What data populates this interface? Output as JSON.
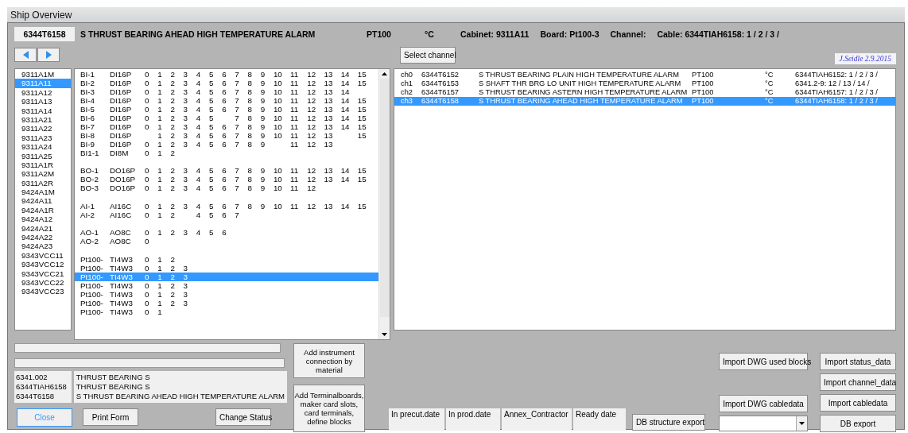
{
  "window": {
    "title": "Ship Overview"
  },
  "header": {
    "tag": "6344T6158",
    "description": "S THRUST BEARING AHEAD HIGH TEMPERATURE ALARM",
    "type": "PT100",
    "unit": "°C",
    "cabinet": "Cabinet: 9311A11",
    "board": "Board: Pt100-3",
    "channel": "Channel:",
    "cable": "Cable: 6344TIAH6158:  1 / 2 / 3 /"
  },
  "select_channel_button": "Select channel",
  "signature": "J.Seidle 2.9.2015",
  "cabinets": [
    {
      "label": "9311A1M",
      "selected": false
    },
    {
      "label": "9311A11",
      "selected": true
    },
    {
      "label": "9311A12",
      "selected": false
    },
    {
      "label": "9311A13",
      "selected": false
    },
    {
      "label": "9311A14",
      "selected": false
    },
    {
      "label": "9311A21",
      "selected": false
    },
    {
      "label": "9311A22",
      "selected": false
    },
    {
      "label": "9311A23",
      "selected": false
    },
    {
      "label": "9311A24",
      "selected": false
    },
    {
      "label": "9311A25",
      "selected": false
    },
    {
      "label": "9311A1R",
      "selected": false
    },
    {
      "label": "9311A2M",
      "selected": false
    },
    {
      "label": "9311A2R",
      "selected": false
    },
    {
      "label": "9424A1M",
      "selected": false
    },
    {
      "label": "9424A11",
      "selected": false
    },
    {
      "label": "9424A1R",
      "selected": false
    },
    {
      "label": "9424A12",
      "selected": false
    },
    {
      "label": "9424A21",
      "selected": false
    },
    {
      "label": "9424A22",
      "selected": false
    },
    {
      "label": "9424A23",
      "selected": false
    },
    {
      "label": "9343VCC11",
      "selected": false
    },
    {
      "label": "9343VCC12",
      "selected": false
    },
    {
      "label": "9343VCC21",
      "selected": false
    },
    {
      "label": "9343VCC22",
      "selected": false
    },
    {
      "label": "9343VCC23",
      "selected": false
    }
  ],
  "board_groups": [
    {
      "rows": [
        {
          "name": "BI-1",
          "type": "DI16P",
          "slots": [
            "0",
            "1",
            "2",
            "3",
            "4",
            "5",
            "6",
            "7",
            "8",
            "9",
            "10",
            "11",
            "12",
            "13",
            "14",
            "15"
          ],
          "selected": false
        },
        {
          "name": "BI-2",
          "type": "DI16P",
          "slots": [
            "0",
            "1",
            "2",
            "3",
            "4",
            "5",
            "6",
            "7",
            "8",
            "9",
            "10",
            "11",
            "12",
            "13",
            "14",
            "15"
          ],
          "selected": false
        },
        {
          "name": "BI-3",
          "type": "DI16P",
          "slots": [
            "0",
            "1",
            "2",
            "3",
            "4",
            "5",
            "6",
            "7",
            "8",
            "9",
            "10",
            "11",
            "12",
            "13",
            "14",
            {
              "kind": "gap"
            }
          ],
          "selected": false
        },
        {
          "name": "BI-4",
          "type": "DI16P",
          "slots": [
            "0",
            "1",
            "2",
            "3",
            "4",
            "5",
            "6",
            "7",
            "8",
            "9",
            "10",
            "11",
            "12",
            "13",
            "14",
            "15"
          ],
          "selected": false
        },
        {
          "name": "BI-5",
          "type": "DI16P",
          "slots": [
            "0",
            "1",
            "2",
            "3",
            "4",
            "5",
            "6",
            "7",
            "8",
            "9",
            "10",
            "11",
            "12",
            "13",
            "14",
            "15"
          ],
          "selected": false
        },
        {
          "name": "BI-6",
          "type": "DI16P",
          "slots": [
            "0",
            "1",
            "2",
            "3",
            "4",
            "5",
            {
              "kind": "gap"
            },
            "7",
            "8",
            "9",
            "10",
            "11",
            "12",
            "13",
            "14",
            "15"
          ],
          "selected": false
        },
        {
          "name": "BI-7",
          "type": "DI16P",
          "slots": [
            "0",
            "1",
            "2",
            "3",
            "4",
            "5",
            "6",
            "7",
            "8",
            "9",
            "10",
            "11",
            "12",
            "13",
            "14",
            "15"
          ],
          "selected": false
        },
        {
          "name": "BI-8",
          "type": "DI16P",
          "slots": [
            {
              "kind": "gap"
            },
            "1",
            "2",
            "3",
            "4",
            "5",
            "6",
            "7",
            "8",
            "9",
            "10",
            "11",
            "12",
            "13",
            {
              "kind": "gap"
            },
            "15"
          ],
          "selected": false
        },
        {
          "name": "BI-9",
          "type": "DI16P",
          "slots": [
            "0",
            "1",
            "2",
            "3",
            "4",
            "5",
            "6",
            "7",
            "8",
            "9",
            {
              "kind": "gap"
            },
            "11",
            "12",
            "13"
          ],
          "selected": false
        },
        {
          "name": "BI1-1",
          "type": "DI8M",
          "slots": [
            "0",
            "1",
            "2"
          ],
          "selected": false
        }
      ]
    },
    {
      "rows": [
        {
          "name": "BO-1",
          "type": "DO16P",
          "slots": [
            "0",
            "1",
            "2",
            "3",
            "4",
            "5",
            "6",
            "7",
            "8",
            "9",
            "10",
            "11",
            "12",
            "13",
            "14",
            "15"
          ],
          "selected": false
        },
        {
          "name": "BO-2",
          "type": "DO16P",
          "slots": [
            "0",
            "1",
            "2",
            "3",
            "4",
            "5",
            "6",
            "7",
            "8",
            "9",
            "10",
            "11",
            "12",
            "13",
            "14",
            "15"
          ],
          "selected": false
        },
        {
          "name": "BO-3",
          "type": "DO16P",
          "slots": [
            "0",
            "1",
            "2",
            "3",
            "4",
            "5",
            "6",
            "7",
            "8",
            "9",
            "10",
            "11",
            "12"
          ],
          "selected": false
        }
      ]
    },
    {
      "rows": [
        {
          "name": "AI-1",
          "type": "AI16C",
          "slots": [
            "0",
            "1",
            "2",
            "3",
            "4",
            "5",
            "6",
            "7",
            "8",
            "9",
            "10",
            "11",
            "12",
            "13",
            "14",
            "15"
          ],
          "selected": false
        },
        {
          "name": "AI-2",
          "type": "AI16C",
          "slots": [
            "0",
            "1",
            "2",
            {
              "kind": "gap"
            },
            "4",
            "5",
            "6",
            "7"
          ],
          "selected": false
        }
      ]
    },
    {
      "rows": [
        {
          "name": "AO-1",
          "type": "AO8C",
          "slots": [
            "0",
            "1",
            "2",
            "3",
            "4",
            "5",
            "6"
          ],
          "selected": false
        },
        {
          "name": "AO-2",
          "type": "AO8C",
          "slots": [
            "0"
          ],
          "selected": false
        }
      ]
    },
    {
      "rows": [
        {
          "name": "Pt100-",
          "type": "TI4W3",
          "slots": [
            "0",
            "1",
            "2"
          ],
          "selected": false
        },
        {
          "name": "Pt100-",
          "type": "TI4W3",
          "slots": [
            "0",
            "1",
            "2",
            "3"
          ],
          "selected": false
        },
        {
          "name": "Pt100-",
          "type": "TI4W3",
          "slots": [
            "0",
            "1",
            "2",
            "3"
          ],
          "selected": true
        },
        {
          "name": "Pt100-",
          "type": "TI4W3",
          "slots": [
            "0",
            "1",
            "2",
            "3"
          ],
          "selected": false
        },
        {
          "name": "Pt100-",
          "type": "TI4W3",
          "slots": [
            "0",
            "1",
            "2",
            "3"
          ],
          "selected": false
        },
        {
          "name": "Pt100-",
          "type": "TI4W3",
          "slots": [
            "0",
            "1",
            "2",
            "3"
          ],
          "selected": false
        },
        {
          "name": "Pt100-",
          "type": "TI4W3",
          "slots": [
            "0",
            "1"
          ],
          "selected": false
        }
      ]
    }
  ],
  "channels": [
    {
      "channel": "ch0",
      "tag": "6344T6152",
      "description": "S THRUST BEARING PLAIN HIGH TEMPERATURE ALARM",
      "type": "PT100",
      "unit": "°C",
      "cable": "6344TIAH6152: 1 / 2 / 3 /",
      "selected": false
    },
    {
      "channel": "ch1",
      "tag": "6344T6153",
      "description": "S SHAFT THR BRG LO UNIT HIGH TEMPERATURE ALARM",
      "type": "PT100",
      "unit": "°C",
      "cable": "6341.2-9: 12 / 13 / 14 /",
      "selected": false
    },
    {
      "channel": "ch2",
      "tag": "6344T6157",
      "description": "S THRUST BEARING ASTERN HIGH TEMPERATURE ALARM",
      "type": "PT100",
      "unit": "°C",
      "cable": "6344TIAH6157: 1 / 2 / 3 /",
      "selected": false
    },
    {
      "channel": "ch3",
      "tag": "6344T6158",
      "description": "S THRUST BEARING AHEAD HIGH TEMPERATURE ALARM",
      "type": "PT100",
      "unit": "°C",
      "cable": "6344TIAH6158: 1 / 2 / 3 /",
      "selected": true
    }
  ],
  "info": [
    {
      "code": "6341.002",
      "text": "THRUST BEARING S"
    },
    {
      "code": "6344TIAH6158",
      "text": "THRUST BEARING S"
    },
    {
      "code": "6344T6158",
      "text": "S THRUST BEARING AHEAD HIGH TEMPERATURE ALARM"
    }
  ],
  "buttons": {
    "add_instrument": "Add instrument connection by material",
    "add_terminalboards": "Add Terminalboards, maker card slots, card terminals, define blocks",
    "close": "Close",
    "print_form": "Print Form",
    "change_status": "Change Status",
    "db_structure_export": "DB structure export",
    "import_dwg_used_blocks": "Import DWG used blocks",
    "import_dwg_cabledata": "Import DWG cabledata",
    "import_status_data": "Import status_data",
    "import_channel_data": "Import channel_data",
    "import_cabledata": "Import cabledata",
    "db_export": "DB export"
  },
  "dates": [
    "In precut.date",
    "In prod.date",
    "Annex_Contractor",
    "Ready date"
  ]
}
